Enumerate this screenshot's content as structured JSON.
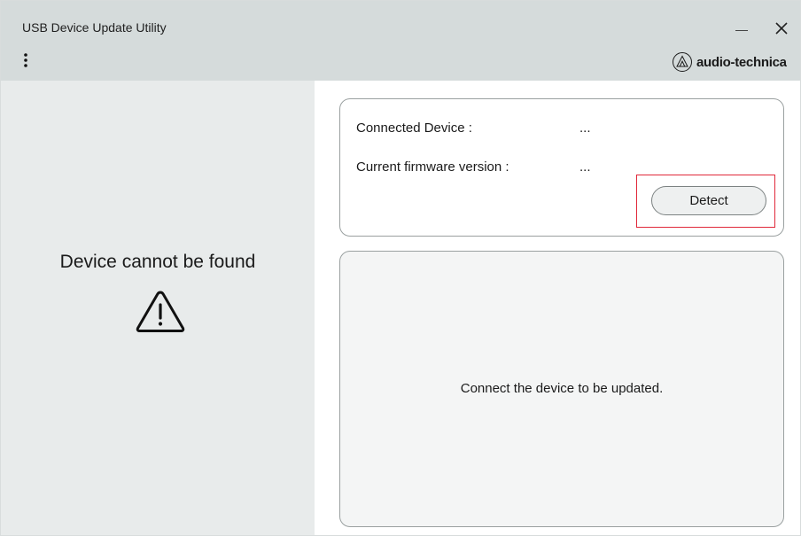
{
  "window": {
    "title": "USB Device Update Utility",
    "minimize_icon": "minimize-icon",
    "close_icon": "close-icon",
    "menu_icon": "more-vertical-icon"
  },
  "brand": {
    "logo_text": "audio-technica",
    "logo_icon": "audio-technica-logo-icon"
  },
  "left_panel": {
    "status": "Device cannot be found",
    "status_icon": "warning-icon"
  },
  "device_info": {
    "connected_device_label": "Connected Device :",
    "connected_device_value": "...",
    "firmware_label": "Current firmware version :",
    "firmware_value": "...",
    "detect_button_label": "Detect"
  },
  "message_panel": {
    "message": "Connect the device to be updated."
  },
  "colors": {
    "header_bg": "#d5dbdb",
    "left_panel_bg": "#e8ebeb",
    "highlight_border": "#e0283a",
    "card_border": "#9aa0a0"
  }
}
